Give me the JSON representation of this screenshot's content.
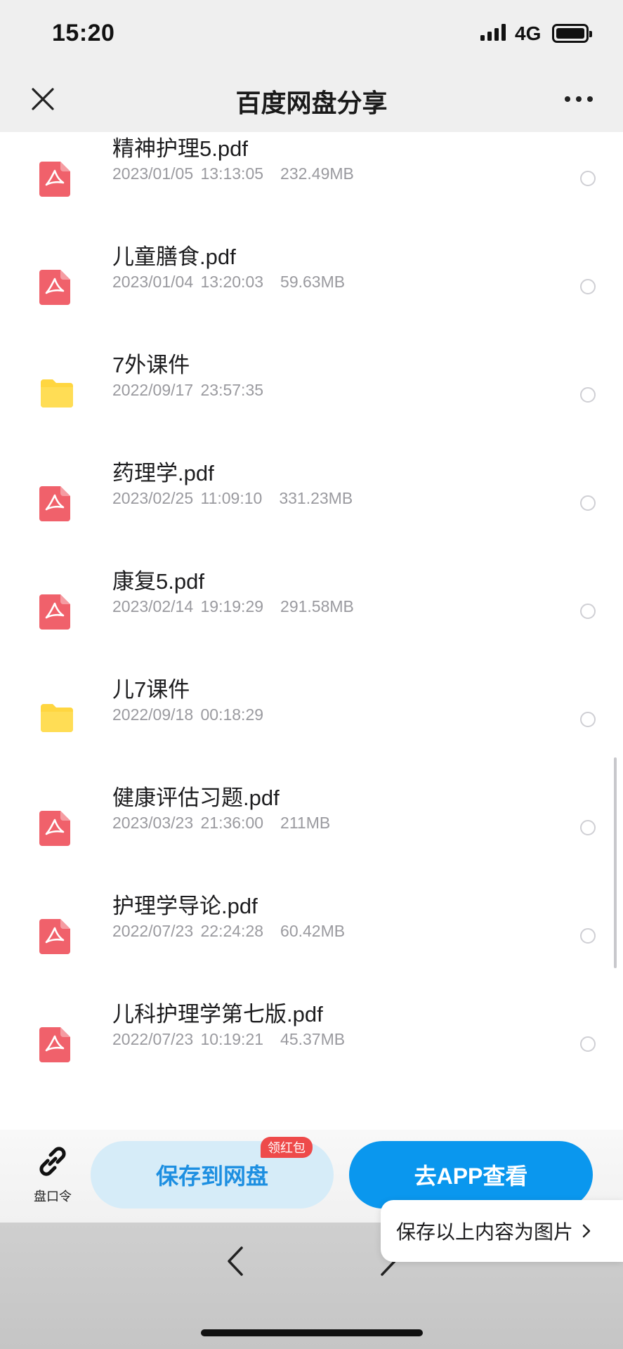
{
  "status_bar": {
    "time": "15:20",
    "network": "4G",
    "icons": [
      "signal-icon",
      "battery-icon"
    ]
  },
  "nav": {
    "title": "百度网盘分享",
    "close_icon": "close-icon",
    "more_icon": "more-icon"
  },
  "files": [
    {
      "name": "精神护理5.pdf",
      "date": "2023/01/05 13:13:05",
      "size": "232.49MB",
      "type": "pdf"
    },
    {
      "name": "儿童膳食.pdf",
      "date": "2023/01/04 13:20:03",
      "size": "59.63MB",
      "type": "pdf"
    },
    {
      "name": "7外课件",
      "date": "2022/09/17 23:57:35",
      "size": "",
      "type": "folder"
    },
    {
      "name": "药理学.pdf",
      "date": "2023/02/25 11:09:10",
      "size": "331.23MB",
      "type": "pdf"
    },
    {
      "name": "康复5.pdf",
      "date": "2023/02/14 19:19:29",
      "size": "291.58MB",
      "type": "pdf"
    },
    {
      "name": "儿7课件",
      "date": "2022/09/18 00:18:29",
      "size": "",
      "type": "folder"
    },
    {
      "name": "健康评估习题.pdf",
      "date": "2023/03/23 21:36:00",
      "size": "211MB",
      "type": "pdf"
    },
    {
      "name": "护理学导论.pdf",
      "date": "2022/07/23 22:24:28",
      "size": "60.42MB",
      "type": "pdf"
    },
    {
      "name": "儿科护理学第七版.pdf",
      "date": "2022/07/23 10:19:21",
      "size": "45.37MB",
      "type": "pdf"
    }
  ],
  "actions": {
    "share_code_label": "盘口令",
    "save_button": "保存到网盘",
    "red_packet_badge": "领红包",
    "app_button": "去APP查看",
    "save_image_popover": "保存以上内容为图片"
  },
  "colors": {
    "pdf_icon": "#f0616b",
    "folder_icon": "#ffd640",
    "primary_blue": "#0a97ee",
    "save_button_bg": "#d6ecf8",
    "badge_red": "#ee4a4a"
  }
}
